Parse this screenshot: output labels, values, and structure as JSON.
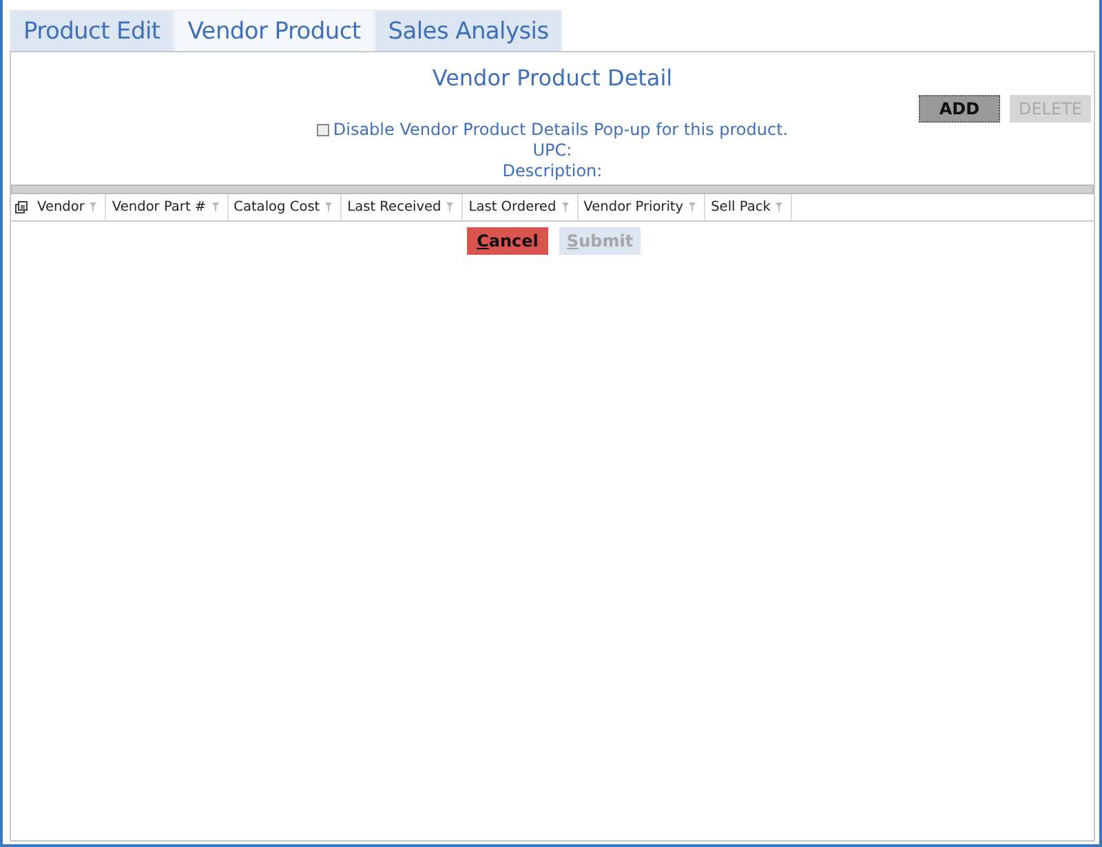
{
  "tabs": [
    {
      "label": "Product Edit",
      "selected": false
    },
    {
      "label": "Vendor Product",
      "selected": true
    },
    {
      "label": "Sales Analysis",
      "selected": false
    }
  ],
  "panel": {
    "title": "Vendor Product Detail",
    "actions": [
      {
        "label": "ADD",
        "disabled": false
      },
      {
        "label": "DELETE",
        "disabled": true
      }
    ],
    "popup_checkbox": {
      "label": "Disable Vendor Product Details Pop-up for this product.",
      "checked": false
    },
    "fields": [
      {
        "label": "UPC:"
      },
      {
        "label": "Description:"
      }
    ],
    "table": {
      "columns": [
        "Vendor",
        "Vendor Part #",
        "Catalog Cost",
        "Last Received",
        "Last Ordered",
        "Vendor Priority",
        "Sell Pack"
      ]
    },
    "footer_buttons": [
      {
        "kind": "cancel",
        "label": "Cancel",
        "disabled": false
      },
      {
        "kind": "submit",
        "label": "Submit",
        "disabled": true
      }
    ]
  }
}
